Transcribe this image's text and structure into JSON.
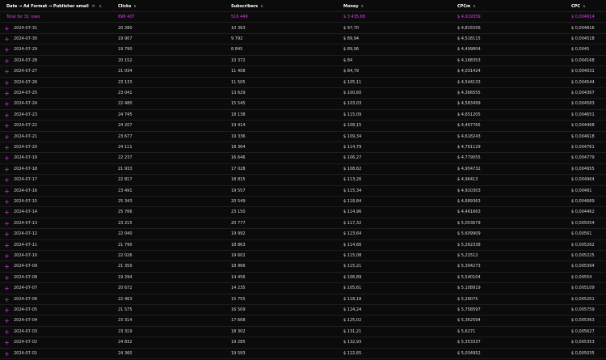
{
  "header": {
    "group_label": "Date → Ad Format → Publisher email",
    "clear_icon": "close-icon",
    "sort_icon": "sort-arrows-icon",
    "columns": [
      "Clicks",
      "Subscribers",
      "Money",
      "CPCm",
      "CPC"
    ]
  },
  "total": {
    "label": "Total for 31 rows",
    "clicks": "698 407",
    "subscribers": "516 449",
    "money": "$ 3 435,68",
    "cpcm": "$ 4,919359",
    "cpc": "$ 0,004914"
  },
  "expand_icon": "plus-icon",
  "rows": [
    {
      "date": "2024-07-31",
      "clicks": "20 280",
      "subscribers": "10 363",
      "money": "$ 97,70",
      "cpcm": "$ 4,815556",
      "cpc": "$ 0,004816"
    },
    {
      "date": "2024-07-30",
      "clicks": "19 907",
      "subscribers": "9 792",
      "money": "$ 89,94",
      "cpcm": "$ 4,518115",
      "cpc": "$ 0,004518"
    },
    {
      "date": "2024-07-29",
      "clicks": "19 790",
      "subscribers": "8 845",
      "money": "$ 89,06",
      "cpcm": "$ 4,499804",
      "cpc": "$ 0,0045"
    },
    {
      "date": "2024-07-28",
      "clicks": "20 152",
      "subscribers": "10 372",
      "money": "$ 84",
      "cpcm": "$ 4,168353",
      "cpc": "$ 0,004168"
    },
    {
      "date": "2024-07-27",
      "clicks": "21 034",
      "subscribers": "11 408",
      "money": "$ 84,79",
      "cpcm": "$ 4,031424",
      "cpc": "$ 0,004031"
    },
    {
      "date": "2024-07-26",
      "clicks": "23 133",
      "subscribers": "11 505",
      "money": "$ 105,11",
      "cpcm": "$ 4,544133",
      "cpc": "$ 0,004544"
    },
    {
      "date": "2024-07-25",
      "clicks": "23 041",
      "subscribers": "13 629",
      "money": "$ 100,60",
      "cpcm": "$ 4,366555",
      "cpc": "$ 0,004367"
    },
    {
      "date": "2024-07-24",
      "clicks": "22 480",
      "subscribers": "15 545",
      "money": "$ 103,03",
      "cpcm": "$ 4,583499",
      "cpc": "$ 0,004583"
    },
    {
      "date": "2024-07-23",
      "clicks": "24 745",
      "subscribers": "18 138",
      "money": "$ 115,09",
      "cpcm": "$ 4,651205",
      "cpc": "$ 0,004651"
    },
    {
      "date": "2024-07-22",
      "clicks": "24 207",
      "subscribers": "19 414",
      "money": "$ 108,15",
      "cpcm": "$ 4,467765",
      "cpc": "$ 0,004468"
    },
    {
      "date": "2024-07-21",
      "clicks": "23 677",
      "subscribers": "19 336",
      "money": "$ 109,34",
      "cpcm": "$ 4,618243",
      "cpc": "$ 0,004618"
    },
    {
      "date": "2024-07-20",
      "clicks": "24 111",
      "subscribers": "18 364",
      "money": "$ 114,79",
      "cpcm": "$ 4,761129",
      "cpc": "$ 0,004761"
    },
    {
      "date": "2024-07-19",
      "clicks": "22 237",
      "subscribers": "16 646",
      "money": "$ 106,27",
      "cpcm": "$ 4,779055",
      "cpc": "$ 0,004779"
    },
    {
      "date": "2024-07-18",
      "clicks": "21 933",
      "subscribers": "17 028",
      "money": "$ 108,62",
      "cpcm": "$ 4,954732",
      "cpc": "$ 0,004955"
    },
    {
      "date": "2024-07-17",
      "clicks": "22 817",
      "subscribers": "18 815",
      "money": "$ 113,26",
      "cpcm": "$ 4,96413",
      "cpc": "$ 0,004964"
    },
    {
      "date": "2024-07-16",
      "clicks": "23 491",
      "subscribers": "19 557",
      "money": "$ 115,34",
      "cpcm": "$ 4,910303",
      "cpc": "$ 0,00491"
    },
    {
      "date": "2024-07-15",
      "clicks": "25 343",
      "subscribers": "20 549",
      "money": "$ 118,84",
      "cpcm": "$ 4,689363",
      "cpc": "$ 0,004689"
    },
    {
      "date": "2024-07-14",
      "clicks": "25 766",
      "subscribers": "23 150",
      "money": "$ 114,96",
      "cpcm": "$ 4,461663",
      "cpc": "$ 0,004462"
    },
    {
      "date": "2024-07-13",
      "clicks": "23 215",
      "subscribers": "20 777",
      "money": "$ 117,32",
      "cpcm": "$ 5,053679",
      "cpc": "$ 0,005054"
    },
    {
      "date": "2024-07-12",
      "clicks": "22 040",
      "subscribers": "19 992",
      "money": "$ 123,64",
      "cpcm": "$ 5,609909",
      "cpc": "$ 0,00561"
    },
    {
      "date": "2024-07-11",
      "clicks": "21 790",
      "subscribers": "18 863",
      "money": "$ 114,66",
      "cpcm": "$ 5,262338",
      "cpc": "$ 0,005262"
    },
    {
      "date": "2024-07-10",
      "clicks": "22 026",
      "subscribers": "19 602",
      "money": "$ 115,08",
      "cpcm": "$ 5,22512",
      "cpc": "$ 0,005225"
    },
    {
      "date": "2024-07-09",
      "clicks": "21 359",
      "subscribers": "18 966",
      "money": "$ 115,21",
      "cpcm": "$ 5,394273",
      "cpc": "$ 0,005394"
    },
    {
      "date": "2024-07-08",
      "clicks": "19 294",
      "subscribers": "14 456",
      "money": "$ 106,89",
      "cpcm": "$ 5,540104",
      "cpc": "$ 0,00554"
    },
    {
      "date": "2024-07-07",
      "clicks": "20 672",
      "subscribers": "14 235",
      "money": "$ 105,61",
      "cpcm": "$ 5,108919",
      "cpc": "$ 0,005109"
    },
    {
      "date": "2024-07-06",
      "clicks": "22 463",
      "subscribers": "15 755",
      "money": "$ 118,18",
      "cpcm": "$ 5,26075",
      "cpc": "$ 0,005261"
    },
    {
      "date": "2024-07-05",
      "clicks": "21 575",
      "subscribers": "16 509",
      "money": "$ 124,24",
      "cpcm": "$ 5,758597",
      "cpc": "$ 0,005759"
    },
    {
      "date": "2024-07-04",
      "clicks": "23 314",
      "subscribers": "17 668",
      "money": "$ 125,02",
      "cpcm": "$ 5,362594",
      "cpc": "$ 0,005363"
    },
    {
      "date": "2024-07-03",
      "clicks": "23 319",
      "subscribers": "18 302",
      "money": "$ 131,21",
      "cpcm": "$ 5,6271",
      "cpc": "$ 0,005627"
    },
    {
      "date": "2024-07-02",
      "clicks": "24 832",
      "subscribers": "19 285",
      "money": "$ 132,93",
      "cpcm": "$ 5,353337",
      "cpc": "$ 0,005353"
    },
    {
      "date": "2024-07-01",
      "clicks": "24 360",
      "subscribers": "19 593",
      "money": "$ 122,65",
      "cpcm": "$ 5,034952",
      "cpc": "$ 0,005035"
    }
  ]
}
